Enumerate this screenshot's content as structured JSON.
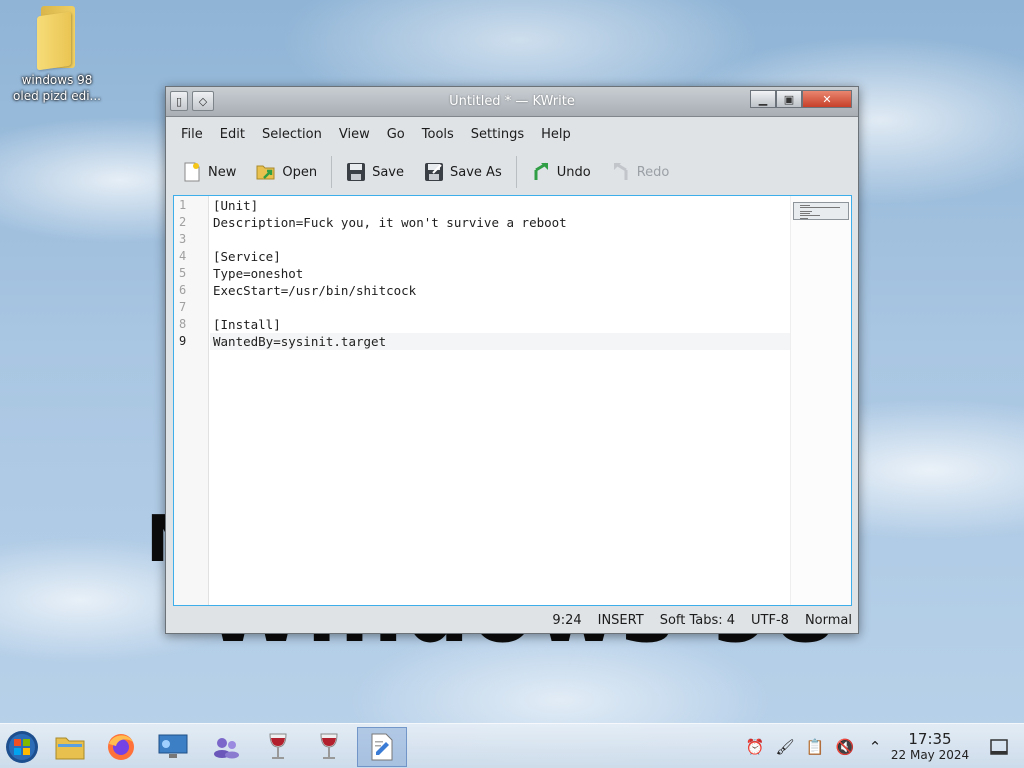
{
  "desktop": {
    "icon_label": "windows 98 oled pizd edi...",
    "icon_label_line1": "windows 98",
    "icon_label_line2": "oled pizd edi..."
  },
  "window": {
    "title": "Untitled * — KWrite",
    "menu": [
      "File",
      "Edit",
      "Selection",
      "View",
      "Go",
      "Tools",
      "Settings",
      "Help"
    ],
    "toolbar": {
      "new": "New",
      "open": "Open",
      "save": "Save",
      "save_as": "Save As",
      "undo": "Undo",
      "redo": "Redo"
    },
    "line_numbers": [
      "1",
      "2",
      "3",
      "4",
      "5",
      "6",
      "7",
      "8",
      "9"
    ],
    "lines": [
      "[Unit]",
      "Description=Fuck you, it won't survive a reboot",
      "",
      "[Service]",
      "Type=oneshot",
      "ExecStart=/usr/bin/shitcock",
      "",
      "[Install]",
      "WantedBy=sysinit.target"
    ],
    "status": {
      "cursor": "9:24",
      "mode": "INSERT",
      "tabs": "Soft Tabs: 4",
      "encoding": "UTF-8",
      "syntax": "Normal"
    }
  },
  "taskbar": {
    "clock_time": "17:35",
    "clock_date": "22 May 2024"
  },
  "colors": {
    "accent": "#3daee9",
    "close_button": "#c7402a"
  }
}
